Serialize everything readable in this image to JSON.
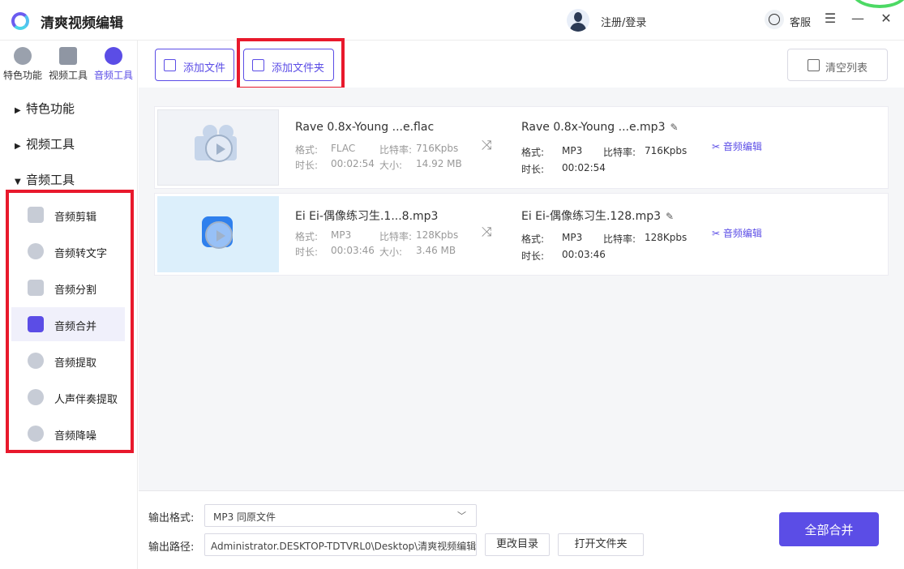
{
  "app": {
    "title": "清爽视频编辑"
  },
  "header": {
    "login_label": "注册/登录",
    "service_label": "客服",
    "minimize": "—",
    "menu": "☰",
    "close": "✕"
  },
  "sidebar": {
    "tabs": [
      {
        "label": "特色功能",
        "icon": "star-icon"
      },
      {
        "label": "视频工具",
        "icon": "film-icon"
      },
      {
        "label": "音频工具",
        "icon": "audio-icon",
        "active": true
      }
    ],
    "tree": [
      {
        "label": "特色功能",
        "expanded": false
      },
      {
        "label": "视频工具",
        "expanded": false
      },
      {
        "label": "音频工具",
        "expanded": true
      }
    ],
    "audio_items": [
      {
        "label": "音频剪辑"
      },
      {
        "label": "音频转文字"
      },
      {
        "label": "音频分割"
      },
      {
        "label": "音频合并",
        "active": true
      },
      {
        "label": "音频提取"
      },
      {
        "label": "人声伴奏提取"
      },
      {
        "label": "音频降噪"
      }
    ]
  },
  "toolbar": {
    "add_file": "添加文件",
    "add_folder": "添加文件夹",
    "clear_list": "清空列表"
  },
  "files": [
    {
      "src_name": "Rave 0.8x-Young ...e.flac",
      "src_format_label": "格式:",
      "src_format": "FLAC",
      "src_bitrate_label": "比特率:",
      "src_bitrate": "716Kpbs",
      "src_duration_label": "时长:",
      "src_duration": "00:02:54",
      "src_size_label": "大小:",
      "src_size": "14.92 MB",
      "out_name": "Rave 0.8x-Young ...e.mp3",
      "out_format_label": "格式:",
      "out_format": "MP3",
      "out_bitrate_label": "比特率:",
      "out_bitrate": "716Kpbs",
      "out_duration_label": "时长:",
      "out_duration": "00:02:54",
      "edit_label": "音频编辑"
    },
    {
      "src_name": "Ei Ei-偶像练习生.1...8.mp3",
      "src_format_label": "格式:",
      "src_format": "MP3",
      "src_bitrate_label": "比特率:",
      "src_bitrate": "128Kpbs",
      "src_duration_label": "时长:",
      "src_duration": "00:03:46",
      "src_size_label": "大小:",
      "src_size": "3.46 MB",
      "out_name": "Ei Ei-偶像练习生.128.mp3",
      "out_format_label": "格式:",
      "out_format": "MP3",
      "out_bitrate_label": "比特率:",
      "out_bitrate": "128Kpbs",
      "out_duration_label": "时长:",
      "out_duration": "00:03:46",
      "edit_label": "音频编辑"
    }
  ],
  "bottom": {
    "format_label": "输出格式:",
    "format_value": "MP3  同原文件",
    "path_label": "输出路径:",
    "path_value": "Administrator.DESKTOP-TDTVRL0\\Desktop\\清爽视频编辑",
    "change_dir": "更改目录",
    "open_folder": "打开文件夹",
    "merge_all": "全部合并"
  },
  "colors": {
    "accent": "#5b4de6",
    "highlight_box": "#e8192c"
  }
}
